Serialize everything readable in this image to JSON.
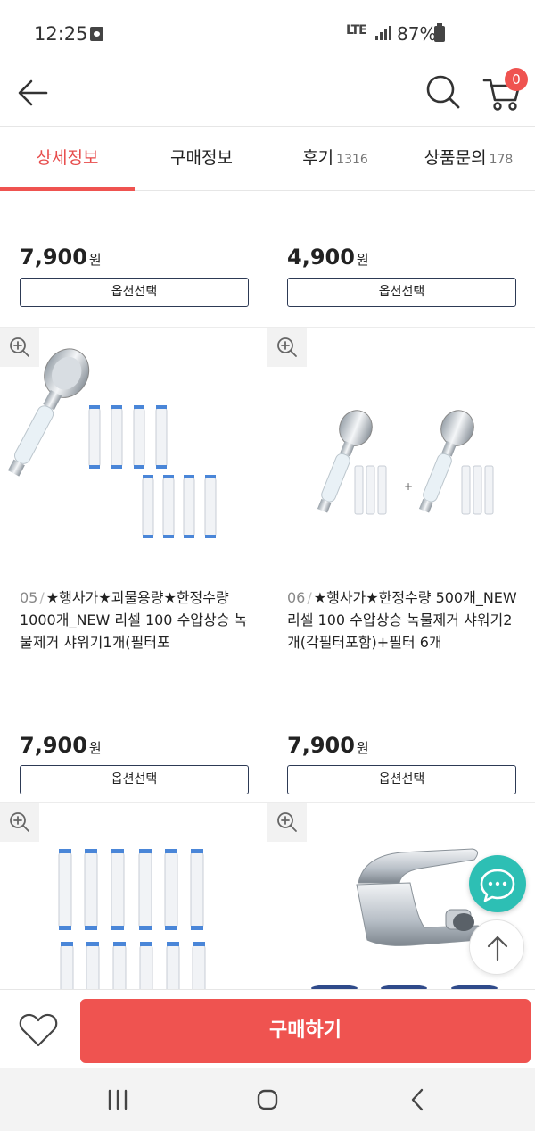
{
  "status_bar": {
    "time": "12:25",
    "network": "LTE",
    "battery": "87%"
  },
  "header": {
    "cart_count": "0"
  },
  "tabs": [
    {
      "label": "상세정보",
      "count": ""
    },
    {
      "label": "구매정보",
      "count": ""
    },
    {
      "label": "후기",
      "count": "1316"
    },
    {
      "label": "상품문의",
      "count": "178"
    }
  ],
  "products": [
    {
      "price": "7,900",
      "currency": "원",
      "option_label": "옵션선택"
    },
    {
      "price": "4,900",
      "currency": "원",
      "option_label": "옵션선택"
    },
    {
      "number": "05",
      "name": "★행사가★괴물용량★한정수량 1000개_NEW 리셀 100 수압상승 녹물제거 샤워기1개(필터포",
      "price": "7,900",
      "currency": "원",
      "option_label": "옵션선택"
    },
    {
      "number": "06",
      "name": "★행사가★한정수량 500개_NEW 리셀 100 수압상승 녹물제거 샤워기2개(각필터포함)+필터 6개",
      "price": "7,900",
      "currency": "원",
      "option_label": "옵션선택"
    }
  ],
  "separator": "/",
  "buy_bar": {
    "buy_label": "구매하기"
  },
  "colors": {
    "accent": "#ef5350",
    "chat": "#2dbfb4",
    "button_border": "#2d3a55"
  }
}
